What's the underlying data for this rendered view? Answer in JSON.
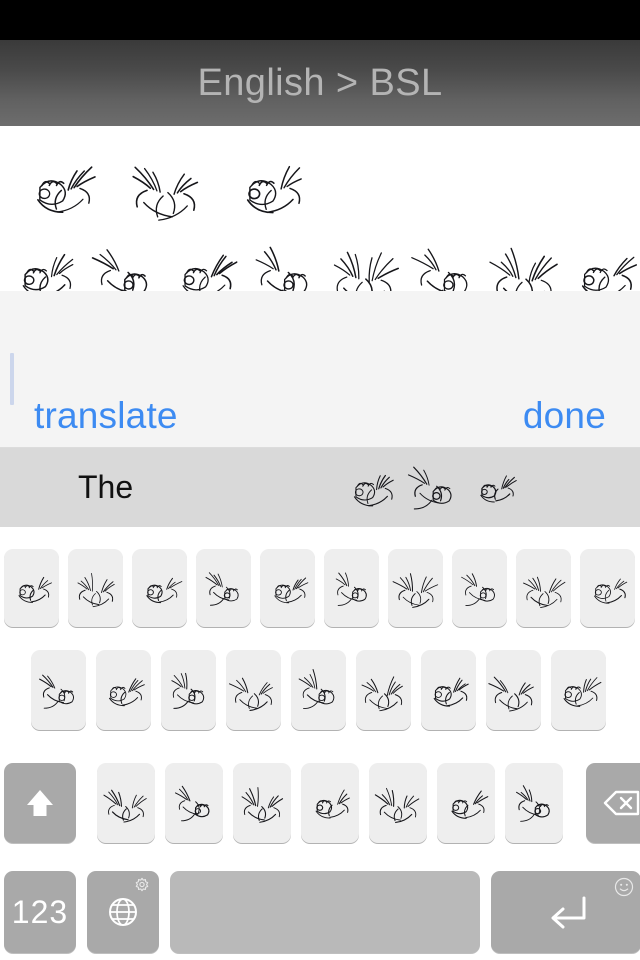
{
  "app": {
    "status_bar": {
      "visible": true,
      "color": "#000000"
    },
    "header": {
      "title": "English > BSL",
      "title_color": "#b4b4b4",
      "background_top": "#3a3a3a",
      "background_bottom": "#6d6d6d"
    }
  },
  "translation_output": {
    "description": "British Sign Language hand-shape line drawings rendering the translated sentence",
    "row1_sign_count": 3,
    "row2_sign_count": 8
  },
  "editor": {
    "background": "#f4f4f4",
    "caret_color": "#ccd6ec",
    "input_value": "",
    "translate_label": "translate",
    "done_label": "done",
    "link_color": "#3d8bf2"
  },
  "suggestion_bar": {
    "background": "#d9d9d9",
    "word": "The",
    "sign_count": 3
  },
  "keyboard": {
    "key_background": "#eeeeee",
    "function_key_background": "#a9a9a9",
    "space_key_background": "#b9b9b9",
    "rows": [
      {
        "name": "row-1",
        "sign_key_count": 10
      },
      {
        "name": "row-2",
        "sign_key_count": 9
      },
      {
        "name": "row-3",
        "shift_icon": "shift-arrow-icon",
        "sign_key_count": 7,
        "backspace_icon": "backspace-icon"
      },
      {
        "name": "row-4",
        "numbers_label": "123",
        "globe_icon": "globe-icon",
        "globe_badge_icon": "gear-icon",
        "space_label": "",
        "return_icon": "return-arrow-icon",
        "return_badge_icon": "smiley-icon"
      }
    ]
  }
}
